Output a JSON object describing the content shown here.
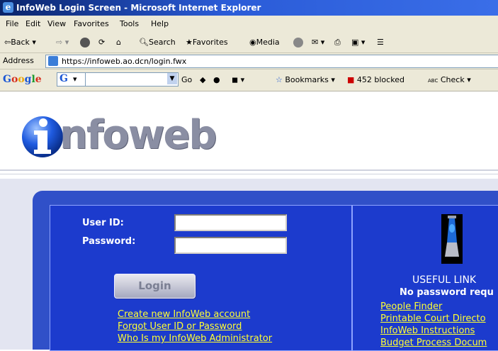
{
  "window": {
    "title": "InfoWeb Login Screen - Microsoft Internet Explorer"
  },
  "menu": [
    "File",
    "Edit",
    "View",
    "Favorites",
    "Tools",
    "Help"
  ],
  "toolbar": {
    "back": "Back",
    "search": "Search",
    "favorites": "Favorites",
    "media": "Media"
  },
  "address": {
    "label": "Address",
    "url": "https://infoweb.ao.dcn/login.fwx"
  },
  "googlebar": {
    "logo": "Google",
    "go": "Go",
    "bookmarks": "Bookmarks",
    "blocked": "452 blocked",
    "check": "Check",
    "abc": "ABC"
  },
  "page": {
    "logo_text": "nfoweb",
    "login": {
      "user_label": "User ID:",
      "password_label": "Password:",
      "user_value": "",
      "password_value": "",
      "button": "Login",
      "links": [
        "Create new InfoWeb account",
        "Forgot User ID or Password",
        "Who Is my InfoWeb Administrator"
      ]
    },
    "useful": {
      "heading": "USEFUL LINK",
      "subheading": "No password requ",
      "links": [
        "People Finder",
        "Printable Court Directo",
        "InfoWeb Instructions",
        "Budget Process Docum"
      ]
    }
  },
  "colors": {
    "title_bar": "#0a246a",
    "panel_blue": "#1c3bcd",
    "link_yellow": "#ffff33"
  }
}
